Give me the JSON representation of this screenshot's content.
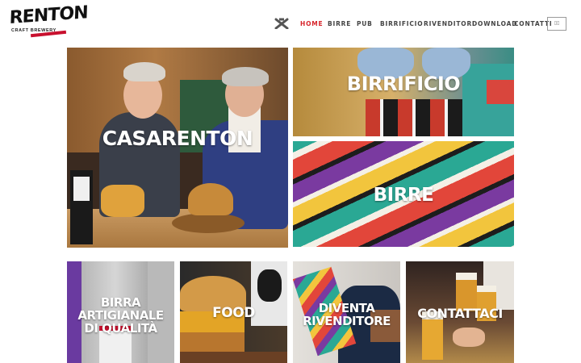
{
  "brand": {
    "name": "RENTON",
    "tagline": "CRAFT BREWERY",
    "accent": "#c8102e"
  },
  "nav": {
    "icon": "crossed-hammers-icon",
    "items": [
      {
        "label": "HOME",
        "active": true
      },
      {
        "label": "BIRRE",
        "active": false
      },
      {
        "label": "PUB",
        "active": false
      },
      {
        "label": "BIRRIFICIO",
        "active": false
      },
      {
        "label": "RIVENDITORI",
        "active": false
      },
      {
        "label": "DOWNLOAD",
        "active": false
      },
      {
        "label": "CONTATTI",
        "active": false
      }
    ],
    "active_color": "#d7262c",
    "lang_button": "▯▯"
  },
  "tiles": {
    "casarenton": "CASARENTON",
    "birrificio": "BIRRIFICIO",
    "birre": "BIRRE",
    "birra_artigianale": [
      "BIRRA",
      "ARTIGIANALE",
      "DI QUALITÀ"
    ],
    "food": "FOOD",
    "diventa_rivenditore": [
      "DIVENTA",
      "RIVENDITORE"
    ],
    "contattaci": "CONTATTACI"
  }
}
